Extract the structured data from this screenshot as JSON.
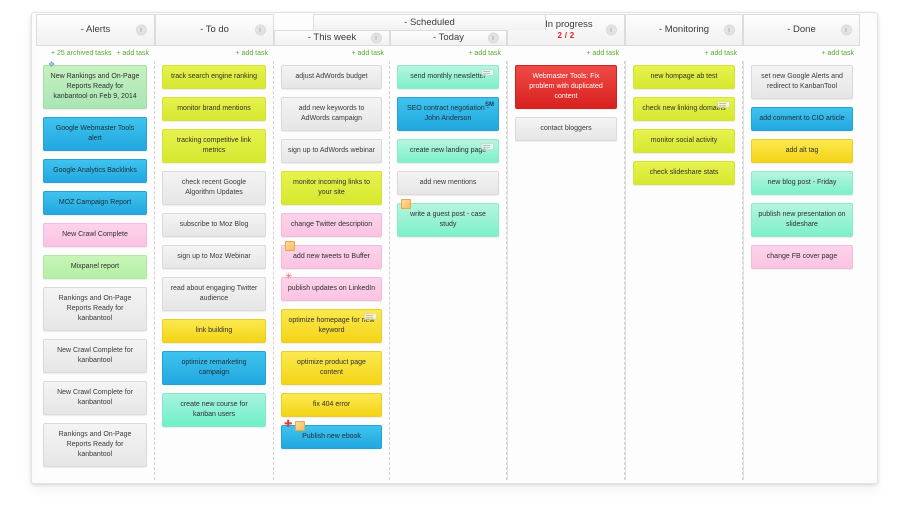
{
  "board": {
    "group_header": {
      "label": "- Scheduled"
    },
    "archived_label": "+ 25 archived tasks",
    "add_task_label": "+ add task",
    "columns": [
      {
        "name": "alerts",
        "title": "- Alerts",
        "wip": "",
        "has_archived_link": true,
        "cards": [
          {
            "text": "New Rankings and On-Page Reports Ready for kanbantool on Feb 9, 2014",
            "color": "green",
            "icon": "diamond-icon",
            "tall": true
          },
          {
            "text": "Google Webmaster Tools alert",
            "color": "blue"
          },
          {
            "text": "Google Analytics Backlinks",
            "color": "blue"
          },
          {
            "text": "MOZ Campaign Report",
            "color": "blue"
          },
          {
            "text": "New Crawl Complete",
            "color": "pink"
          },
          {
            "text": "Mixpanel report",
            "color": "lgreen"
          },
          {
            "text": "Rankings and On-Page Reports Ready for kanbantool",
            "color": "gray",
            "tall": true
          },
          {
            "text": "New Crawl Complete for kanbantool",
            "color": "gray",
            "tall": true
          },
          {
            "text": "New Crawl Complete for kanbantool",
            "color": "gray",
            "tall": true
          },
          {
            "text": "Rankings and On-Page Reports Ready for kanbantool",
            "color": "gray",
            "tall": true
          }
        ]
      },
      {
        "name": "to-do",
        "title": "- To do",
        "wip": "",
        "cards": [
          {
            "text": "track search engine ranking",
            "color": "lime"
          },
          {
            "text": "monitor brand mentions",
            "color": "lime"
          },
          {
            "text": "tracking competitive link metrics",
            "color": "lime",
            "tall": true
          },
          {
            "text": "check recent Google Algorithm Updates",
            "color": "gray",
            "tall": true
          },
          {
            "text": "subscribe to Moz Blog",
            "color": "gray"
          },
          {
            "text": "sign up to Moz Webinar",
            "color": "gray"
          },
          {
            "text": "read about engaging Twitter audience",
            "color": "gray",
            "tall": true
          },
          {
            "text": "link building",
            "color": "yellow"
          },
          {
            "text": "optimize remarketing campaign",
            "color": "blue",
            "tall": true
          },
          {
            "text": "create new course for kanban users",
            "color": "teal",
            "tall": true
          }
        ]
      },
      {
        "name": "this-week",
        "title": "- This week",
        "wip": "",
        "in_group": true,
        "cards": [
          {
            "text": "adjust AdWords budget",
            "color": "gray"
          },
          {
            "text": "add new keywords to AdWords campaign",
            "color": "gray",
            "tall": true
          },
          {
            "text": "sign up to AdWords webinar",
            "color": "gray"
          },
          {
            "text": "monitor incoming links to your site",
            "color": "lime",
            "tall": true
          },
          {
            "text": "change Twitter description",
            "color": "pink"
          },
          {
            "text": "add new tweets to Buffer",
            "color": "pink",
            "icon": "note-icon"
          },
          {
            "text": "publish updates on LinkedIn",
            "color": "pink",
            "icon": "star-icon"
          },
          {
            "text": "optimize homepage for new keyword",
            "color": "yellow",
            "icon": "lines-icon",
            "tall": true
          },
          {
            "text": "optimize product page content",
            "color": "yellow"
          },
          {
            "text": "fix 404 error",
            "color": "yellow"
          },
          {
            "text": "Publish new ebook",
            "color": "blue",
            "icon": "plus-note-icon"
          }
        ]
      },
      {
        "name": "today",
        "title": "- Today",
        "wip": "",
        "in_group": true,
        "cards": [
          {
            "text": "send monthly newsletter",
            "color": "mint",
            "icon": "lines-icon"
          },
          {
            "text": "SEO contract negotiation - John Anderson",
            "color": "blue",
            "badge": "SM",
            "tall": true
          },
          {
            "text": "create new landing page",
            "color": "mint",
            "icon": "lines-icon"
          },
          {
            "text": "add new mentions",
            "color": "gray"
          },
          {
            "text": "write a guest post - case study",
            "color": "mint",
            "icon": "note-icon"
          }
        ]
      },
      {
        "name": "in-progress",
        "title": "- In progress",
        "wip": "2 / 2",
        "cards": [
          {
            "text": "Webmaster Tools: Fix problem with duplicated content",
            "color": "red",
            "tall": true
          },
          {
            "text": "contact bloggers",
            "color": "gray"
          }
        ]
      },
      {
        "name": "monitoring",
        "title": "- Monitoring",
        "wip": "",
        "cards": [
          {
            "text": "new hompage ab test",
            "color": "lime"
          },
          {
            "text": "check new linking domains",
            "color": "lime",
            "icon": "lines-icon"
          },
          {
            "text": "monitor social activity",
            "color": "lime"
          },
          {
            "text": "check slideshare stats",
            "color": "lime"
          }
        ]
      },
      {
        "name": "done",
        "title": "- Done",
        "wip": "",
        "cards": [
          {
            "text": "set new Google Alerts and redirect to KanbanTool",
            "color": "gray",
            "tall": true
          },
          {
            "text": "add comment to CIO article",
            "color": "blue"
          },
          {
            "text": "add alt tag",
            "color": "yellow"
          },
          {
            "text": "new blog post - Friday",
            "color": "mint"
          },
          {
            "text": "publish new presentation on slideshare",
            "color": "mint",
            "tall": true
          },
          {
            "text": "change FB cover page",
            "color": "pink"
          }
        ]
      }
    ]
  }
}
